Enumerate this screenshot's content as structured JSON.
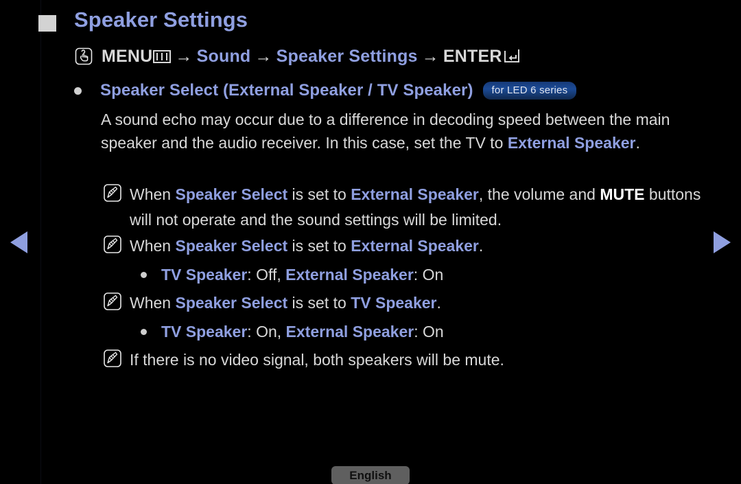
{
  "page": {
    "title": "Speaker Settings",
    "marker_icon": "square-marker-icon"
  },
  "breadcrumb": {
    "hand_icon": "hand-press-icon",
    "menu_label": "MENU",
    "menu_icon": "menu-bars-icon",
    "arrow1": "→",
    "sound_label": "Sound",
    "arrow2": "→",
    "speaker_settings_label": "Speaker Settings",
    "arrow3": "→",
    "enter_label": "ENTER",
    "enter_icon": "enter-return-icon"
  },
  "section": {
    "bullet_icon": "bullet-dot-icon",
    "title": "Speaker Select (External Speaker / TV Speaker)",
    "badge": "for LED 6 series"
  },
  "paragraph": {
    "part1": "A sound echo may occur due to a difference in decoding speed between the main speaker and the audio receiver. In this case, set the TV to ",
    "bold1": "External Speaker",
    "part2": "."
  },
  "notes": [
    {
      "icon": "note-pencil-icon",
      "segments": [
        {
          "text": "When ",
          "style": "normal"
        },
        {
          "text": "Speaker Select",
          "style": "accent"
        },
        {
          "text": " is set to ",
          "style": "normal"
        },
        {
          "text": "External Speaker",
          "style": "accent"
        },
        {
          "text": ", the volume and ",
          "style": "normal"
        },
        {
          "text": "MUTE",
          "style": "white-bold"
        },
        {
          "text": " buttons will not operate and the sound settings will be limited.",
          "style": "normal"
        }
      ]
    },
    {
      "icon": "note-pencil-icon",
      "segments": [
        {
          "text": "When ",
          "style": "normal"
        },
        {
          "text": "Speaker Select",
          "style": "accent"
        },
        {
          "text": " is set to ",
          "style": "normal"
        },
        {
          "text": "External Speaker",
          "style": "accent"
        },
        {
          "text": ".",
          "style": "normal"
        }
      ]
    },
    {
      "icon": "note-pencil-icon",
      "segments": [
        {
          "text": "When ",
          "style": "normal"
        },
        {
          "text": "Speaker Select",
          "style": "accent"
        },
        {
          "text": " is set to ",
          "style": "normal"
        },
        {
          "text": "TV Speaker",
          "style": "accent"
        },
        {
          "text": ".",
          "style": "normal"
        }
      ]
    },
    {
      "icon": "note-pencil-icon",
      "segments": [
        {
          "text": "If there is no video signal, both speakers will be mute.",
          "style": "normal"
        }
      ]
    }
  ],
  "subbullets": [
    {
      "icon": "bullet-dot-icon",
      "segments": [
        {
          "text": "TV Speaker",
          "style": "accent"
        },
        {
          "text": ": Off, ",
          "style": "normal"
        },
        {
          "text": "External Speaker",
          "style": "accent"
        },
        {
          "text": ": On",
          "style": "normal"
        }
      ]
    },
    {
      "icon": "bullet-dot-icon",
      "segments": [
        {
          "text": "TV Speaker",
          "style": "accent"
        },
        {
          "text": ": On, ",
          "style": "normal"
        },
        {
          "text": "External Speaker",
          "style": "accent"
        },
        {
          "text": ": On",
          "style": "normal"
        }
      ]
    }
  ],
  "nav": {
    "prev_icon": "arrow-left-icon",
    "next_icon": "arrow-right-icon"
  },
  "footer": {
    "language": "English"
  },
  "colors": {
    "background": "#000000",
    "accent": "#8f9fe0",
    "body_text": "#d8d8d8",
    "badge_blue": "#1b4a96",
    "button_gray": "#5f5f5f"
  }
}
